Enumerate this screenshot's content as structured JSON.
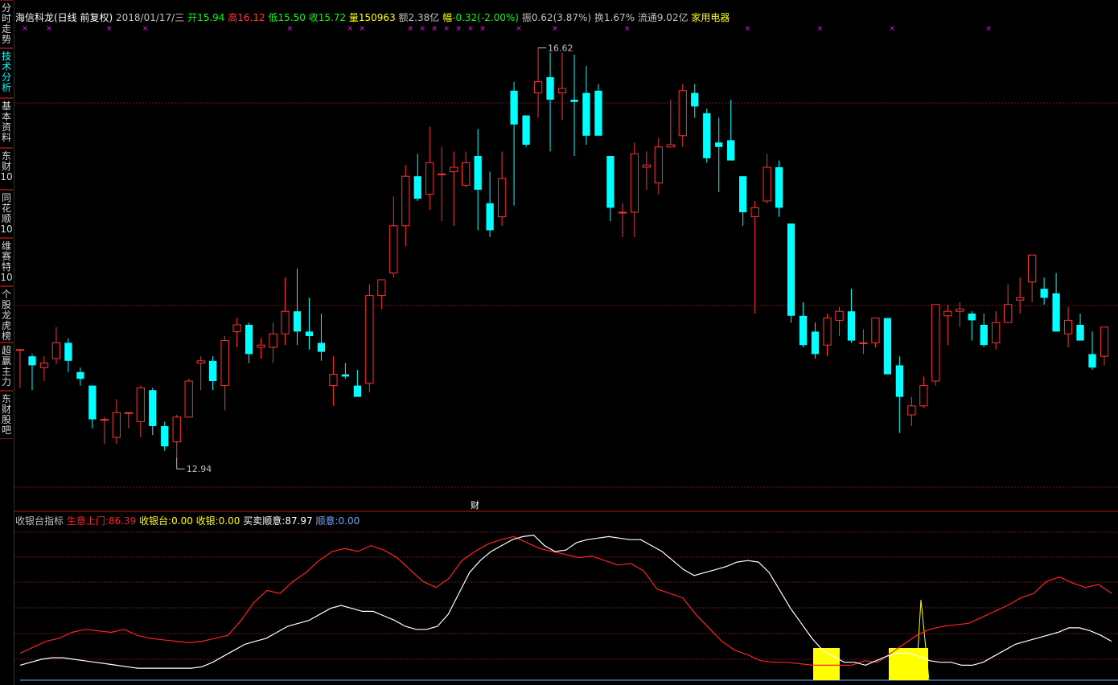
{
  "sidebar": {
    "tabs": [
      {
        "label": "分时走势",
        "active": false
      },
      {
        "label": "技术分析",
        "active": true
      },
      {
        "label": "基本资料",
        "active": false
      },
      {
        "label": "东财10",
        "active": false
      },
      {
        "label": "同花顺10",
        "active": false
      },
      {
        "label": "维赛特10",
        "active": false
      },
      {
        "label": "个股龙虎榜",
        "active": false
      },
      {
        "label": "超赢主力",
        "active": false
      },
      {
        "label": "东财股吧",
        "active": false
      }
    ]
  },
  "header": {
    "title": "海信科龙(日线 前复权)",
    "date": "2018/01/17/三",
    "open_label": "开",
    "open": "15.94",
    "high_label": "高",
    "high": "16.12",
    "low_label": "低",
    "low": "15.50",
    "close_label": "收",
    "close": "15.72",
    "volume_label": "量",
    "volume": "150963",
    "amount_label": "额",
    "amount": "2.38亿",
    "change_label": "幅",
    "change": "-0.32(-2.00%)",
    "amplitude_label": "振",
    "amplitude": "0.62(3.87%)",
    "turnover_label": "换",
    "turnover": "1.67%",
    "float_label": "流通",
    "float_shares": "9.02亿",
    "industry": "家用电器"
  },
  "annotations": {
    "high_label": "16.62",
    "low_label": "12.94",
    "finance_marker": "财"
  },
  "indicator": {
    "name": "收银台指标",
    "line1_label": "生意上门:",
    "line1_value": "86.39",
    "line2_label": "收银台:",
    "line2_value": "0.00",
    "line3_label": "收银:",
    "line3_value": "0.00",
    "line4_label": "买卖顺意:",
    "line4_value": "87.97",
    "line5_label": "顺意:",
    "line5_value": "0.00"
  },
  "colors": {
    "up": "#ff3232",
    "down": "#00ffff",
    "red_line": "#ff2020",
    "white_line": "#ffffff",
    "yellow": "#ffff00",
    "magenta_marker": "#ff00ff",
    "grid": "#7a1010",
    "label_gray": "#c0c0c0"
  },
  "chart_data": [
    {
      "type": "candlestick",
      "title": "海信科龙(日线 前复权)",
      "ylim": [
        12.8,
        16.8
      ],
      "ohlc": [
        [
          13.98,
          13.98,
          13.64,
          13.98
        ],
        [
          13.92,
          13.94,
          13.62,
          13.84
        ],
        [
          13.82,
          13.92,
          13.7,
          13.86
        ],
        [
          13.9,
          14.18,
          13.85,
          14.04
        ],
        [
          14.04,
          14.08,
          13.78,
          13.88
        ],
        [
          13.78,
          13.82,
          13.66,
          13.72
        ],
        [
          13.66,
          13.66,
          13.28,
          13.36
        ],
        [
          13.36,
          13.38,
          13.14,
          13.36
        ],
        [
          13.2,
          13.54,
          13.14,
          13.42
        ],
        [
          13.42,
          13.42,
          13.28,
          13.42
        ],
        [
          13.34,
          13.66,
          13.2,
          13.64
        ],
        [
          13.62,
          13.64,
          13.22,
          13.3
        ],
        [
          13.3,
          13.34,
          13.08,
          13.12
        ],
        [
          13.16,
          13.4,
          13.02,
          13.38
        ],
        [
          13.38,
          13.72,
          13.38,
          13.7
        ],
        [
          13.86,
          13.92,
          13.62,
          13.88
        ],
        [
          13.88,
          13.92,
          13.62,
          13.7
        ],
        [
          13.66,
          14.1,
          13.44,
          14.06
        ],
        [
          14.14,
          14.26,
          14.0,
          14.2
        ],
        [
          14.2,
          14.22,
          13.86,
          13.94
        ],
        [
          14.0,
          14.08,
          13.9,
          14.02
        ],
        [
          14.0,
          14.22,
          13.86,
          14.12
        ],
        [
          14.12,
          14.62,
          14.02,
          14.32
        ],
        [
          14.32,
          14.7,
          14.02,
          14.14
        ],
        [
          14.14,
          14.44,
          13.98,
          14.1
        ],
        [
          14.04,
          14.3,
          13.88,
          13.96
        ],
        [
          13.66,
          13.92,
          13.48,
          13.76
        ],
        [
          13.76,
          13.86,
          13.72,
          13.74
        ],
        [
          13.66,
          13.8,
          13.58,
          13.56
        ],
        [
          13.68,
          14.56,
          13.6,
          14.46
        ],
        [
          14.46,
          14.52,
          14.34,
          14.6
        ],
        [
          14.66,
          15.34,
          14.62,
          15.08
        ],
        [
          15.08,
          15.62,
          14.9,
          15.52
        ],
        [
          15.52,
          15.72,
          15.3,
          15.32
        ],
        [
          15.36,
          15.96,
          15.22,
          15.64
        ],
        [
          15.54,
          15.78,
          15.12,
          15.54
        ],
        [
          15.56,
          15.74,
          15.08,
          15.6
        ],
        [
          15.44,
          15.74,
          15.42,
          15.64
        ],
        [
          15.7,
          15.94,
          15.04,
          15.4
        ],
        [
          15.28,
          15.56,
          14.98,
          15.04
        ],
        [
          15.16,
          15.74,
          15.08,
          15.5
        ],
        [
          16.28,
          16.36,
          15.26,
          15.98
        ],
        [
          16.06,
          16.06,
          15.78,
          15.8
        ],
        [
          16.26,
          16.66,
          16.04,
          16.36
        ],
        [
          16.4,
          16.62,
          15.74,
          16.2
        ],
        [
          16.26,
          16.62,
          16.02,
          16.3
        ],
        [
          16.2,
          16.6,
          15.7,
          16.18
        ],
        [
          16.26,
          16.5,
          15.8,
          15.88
        ],
        [
          16.28,
          16.34,
          15.94,
          15.88
        ],
        [
          15.7,
          15.7,
          15.12,
          15.24
        ],
        [
          15.2,
          15.28,
          14.98,
          15.2
        ],
        [
          15.2,
          15.82,
          14.98,
          15.72
        ],
        [
          15.6,
          15.74,
          15.4,
          15.62
        ],
        [
          15.46,
          15.86,
          15.36,
          15.78
        ],
        [
          15.78,
          16.2,
          15.78,
          15.8
        ],
        [
          15.88,
          16.34,
          15.78,
          16.28
        ],
        [
          16.26,
          16.34,
          16.04,
          16.14
        ],
        [
          16.08,
          16.12,
          15.64,
          15.68
        ],
        [
          15.82,
          16.04,
          15.38,
          15.78
        ],
        [
          15.84,
          16.2,
          15.66,
          15.66
        ],
        [
          15.52,
          15.52,
          15.08,
          15.2
        ],
        [
          15.16,
          15.3,
          14.3,
          15.24
        ],
        [
          15.3,
          15.72,
          15.28,
          15.6
        ],
        [
          15.6,
          15.66,
          15.16,
          15.24
        ],
        [
          15.1,
          15.1,
          14.22,
          14.28
        ],
        [
          14.28,
          14.4,
          14.0,
          14.02
        ],
        [
          14.14,
          14.22,
          13.9,
          13.94
        ],
        [
          14.02,
          14.3,
          13.92,
          14.26
        ],
        [
          14.24,
          14.36,
          14.1,
          14.32
        ],
        [
          14.32,
          14.52,
          14.04,
          14.06
        ],
        [
          14.04,
          14.16,
          13.94,
          14.04
        ],
        [
          14.04,
          14.2,
          14.0,
          14.26
        ],
        [
          14.26,
          14.26,
          13.82,
          13.76
        ],
        [
          13.84,
          13.92,
          13.24,
          13.56
        ],
        [
          13.4,
          13.56,
          13.3,
          13.48
        ],
        [
          13.48,
          13.74,
          13.46,
          13.66
        ],
        [
          13.7,
          14.34,
          13.66,
          14.38
        ],
        [
          14.28,
          14.38,
          14.02,
          14.32
        ],
        [
          14.32,
          14.4,
          14.18,
          14.34
        ],
        [
          14.3,
          14.32,
          14.06,
          14.24
        ],
        [
          14.2,
          14.3,
          14.0,
          14.02
        ],
        [
          14.04,
          14.32,
          13.98,
          14.22
        ],
        [
          14.22,
          14.56,
          14.24,
          14.38
        ],
        [
          14.42,
          14.62,
          14.3,
          14.44
        ],
        [
          14.58,
          14.7,
          14.4,
          14.82
        ],
        [
          14.52,
          14.62,
          14.38,
          14.44
        ],
        [
          14.48,
          14.66,
          14.32,
          14.14
        ],
        [
          14.12,
          14.36,
          14.0,
          14.24
        ],
        [
          14.2,
          14.3,
          14.12,
          14.06
        ],
        [
          13.94,
          14.14,
          13.8,
          13.82
        ],
        [
          13.92,
          14.18,
          13.84,
          14.18
        ]
      ]
    },
    {
      "type": "line",
      "title": "收银台指标",
      "ylim": [
        0,
        100
      ],
      "series": [
        {
          "name": "生意上门",
          "color": "#ff2020",
          "values": [
            18,
            22,
            26,
            28,
            32,
            34,
            33,
            32,
            34,
            30,
            28,
            27,
            26,
            25,
            26,
            28,
            30,
            40,
            52,
            60,
            58,
            66,
            72,
            80,
            86,
            88,
            86,
            90,
            87,
            82,
            74,
            66,
            62,
            68,
            80,
            86,
            91,
            94,
            96,
            92,
            88,
            86,
            84,
            82,
            83,
            80,
            77,
            78,
            73,
            61,
            58,
            55,
            44,
            35,
            26,
            20,
            17,
            13,
            12,
            12,
            11,
            10,
            10,
            10,
            10,
            13,
            12,
            18,
            24,
            30,
            34,
            36,
            37,
            38,
            42,
            46,
            50,
            55,
            58,
            66,
            69,
            65,
            62,
            64,
            58
          ]
        },
        {
          "name": "买卖顺意",
          "color": "#ffffff",
          "values": [
            10,
            12,
            14,
            15,
            15,
            14,
            13,
            12,
            11,
            10,
            9,
            8,
            8,
            8,
            8,
            8,
            8,
            9,
            12,
            16,
            20,
            24,
            26,
            28,
            32,
            36,
            38,
            40,
            44,
            48,
            50,
            48,
            46,
            46,
            43,
            40,
            36,
            34,
            34,
            36,
            44,
            58,
            72,
            80,
            86,
            90,
            94,
            96,
            97,
            90,
            86,
            87,
            92,
            94,
            95,
            96,
            95,
            94,
            94,
            90,
            86,
            80,
            74,
            70,
            72,
            74,
            76,
            79,
            80,
            79,
            72,
            60,
            48,
            38,
            28,
            20,
            16,
            12,
            12,
            10,
            13,
            16,
            18,
            18,
            16,
            13,
            12,
            12,
            10,
            10,
            12,
            16,
            20,
            24,
            26,
            28,
            30,
            32,
            35,
            35,
            33,
            30,
            26
          ]
        }
      ]
    }
  ]
}
